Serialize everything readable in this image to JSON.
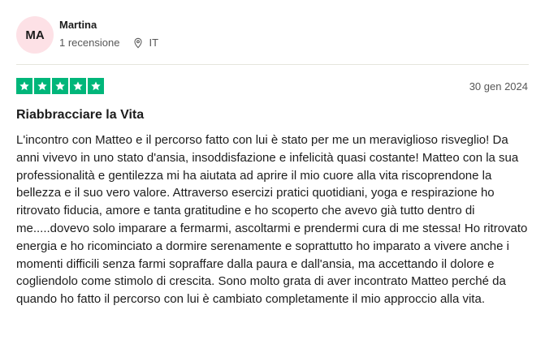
{
  "reviewer": {
    "initials": "MA",
    "name": "Martina",
    "review_count": "1 recensione",
    "country": "IT"
  },
  "review": {
    "rating": 5,
    "rating_max": 5,
    "star_color": "#00b67a",
    "date": "30 gen 2024",
    "title": "Riabbracciare la Vita",
    "text": "L'incontro con Matteo e il percorso fatto con lui è stato per me un meraviglioso risveglio! Da anni vivevo in uno stato d'ansia, insoddisfazione e infelicità quasi costante! Matteo con la sua professionalità e gentilezza mi ha aiutata ad aprire il mio cuore alla vita riscoprendone la bellezza e il suo vero valore. Attraverso esercizi pratici quotidiani, yoga e respirazione ho ritrovato fiducia, amore e tanta gratitudine e ho scoperto che avevo già tutto dentro di me.....dovevo solo imparare a fermarmi, ascoltarmi e prendermi cura di me stessa! Ho ritrovato energia e ho ricominciato a dormire serenamente e soprattutto ho imparato a vivere anche i momenti difficili senza farmi sopraffare dalla paura e dall'ansia, ma accettando il dolore e cogliendolo come stimolo di crescita. Sono molto grata di aver incontrato Matteo perché da quando ho fatto il percorso con lui è cambiato completamente il mio approccio alla vita."
  },
  "icons": {
    "location": "location-pin-icon",
    "star": "star-icon"
  }
}
